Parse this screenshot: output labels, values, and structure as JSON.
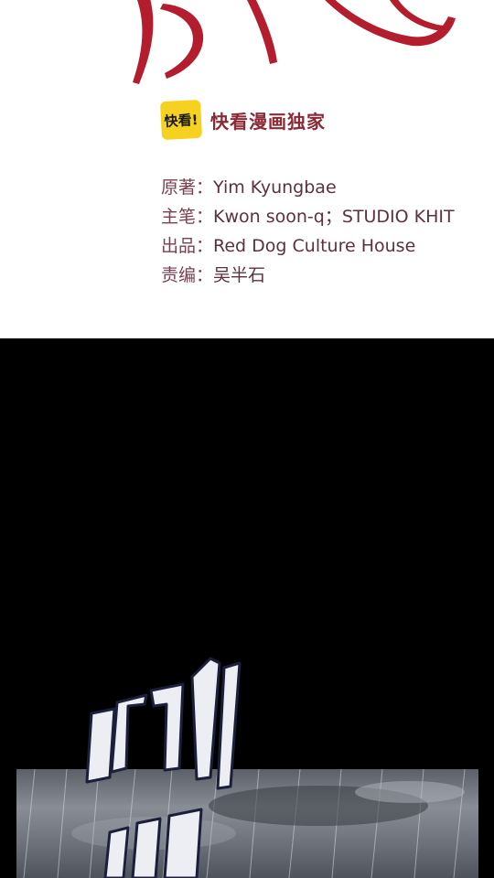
{
  "brand": {
    "badge_text": "快看!",
    "name": "快看漫画独家",
    "badge_color": "#f6d11f",
    "name_color": "#8a2a35"
  },
  "credits": [
    {
      "label": "原著：",
      "value": "Yim Kyungbae"
    },
    {
      "label": "主笔：",
      "value": "Kwon soon-q；STUDIO KHIT"
    },
    {
      "label": "出品：",
      "value": "Red Dog Culture House"
    },
    {
      "label": "责编：",
      "value": "吴半石"
    }
  ],
  "colors": {
    "title_red": "#b31d2e",
    "credit_text": "#5b3040",
    "background_top": "#ffffff",
    "background_dark": "#000000"
  },
  "icons": [
    "title-calligraphy",
    "kuaikan-logo",
    "sfx-lettering",
    "storm-panel"
  ]
}
